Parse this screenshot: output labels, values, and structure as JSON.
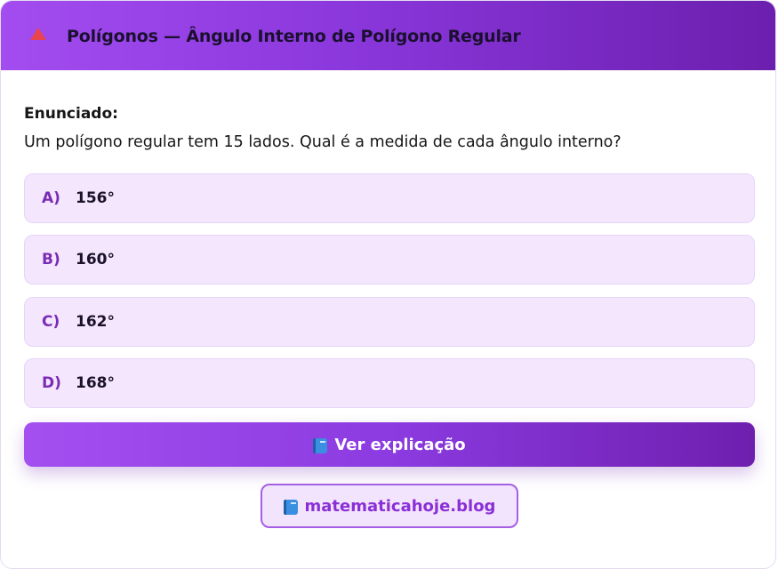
{
  "header": {
    "title": "Polígonos — Ângulo Interno de Polígono Regular",
    "icon": "triangle-icon",
    "icon_color": "#e8454f",
    "gradient": [
      "#a34df0",
      "#6c1fae"
    ]
  },
  "question": {
    "label": "Enunciado:",
    "text": "Um polígono regular tem 15 lados. Qual é a medida de cada ângulo interno?"
  },
  "options": [
    {
      "letter": "A)",
      "value": "156°"
    },
    {
      "letter": "B)",
      "value": "160°"
    },
    {
      "letter": "C)",
      "value": "162°"
    },
    {
      "letter": "D)",
      "value": "168°"
    }
  ],
  "explain_button": {
    "icon": "book-icon",
    "label": "Ver explicação"
  },
  "site_badge": {
    "icon": "book-icon",
    "label": "matematicahoje.blog"
  },
  "colors": {
    "accent": "#8a37dc",
    "option_bg": "#f3e6fd",
    "letter": "#7a2bb5"
  }
}
